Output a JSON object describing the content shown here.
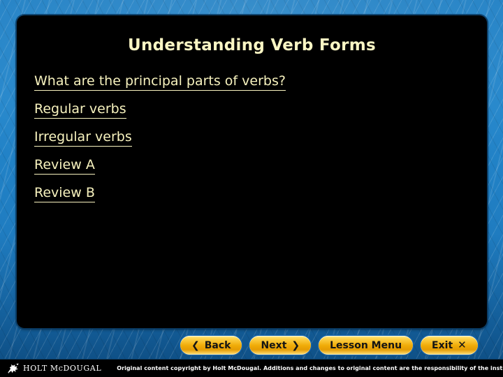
{
  "slide": {
    "title": "Understanding Verb Forms",
    "title_color": "#FAF6C4",
    "panel_color": "#000000",
    "background_color": "#1f7fc5"
  },
  "links": [
    {
      "label": "What are the principal parts of verbs?"
    },
    {
      "label": "Regular verbs"
    },
    {
      "label": "Irregular verbs"
    },
    {
      "label": "Review A"
    },
    {
      "label": "Review B"
    }
  ],
  "nav": {
    "back": {
      "label": "Back",
      "icon": "chevron-left-icon",
      "glyph": "❮"
    },
    "next": {
      "label": "Next",
      "icon": "chevron-right-icon",
      "glyph": "❯"
    },
    "lesson_menu": {
      "label": "Lesson Menu"
    },
    "exit": {
      "label": "Exit",
      "icon": "close-x-icon",
      "glyph": "✕"
    },
    "button_color": "#f0ab07"
  },
  "footer": {
    "logo_icon": "horse-rider-logo-icon",
    "logo_text": "HOLT McDOUGAL",
    "copyright": "Original content copyright by Holt McDougal.  Additions and changes to original content are the responsibility of the instructor."
  }
}
